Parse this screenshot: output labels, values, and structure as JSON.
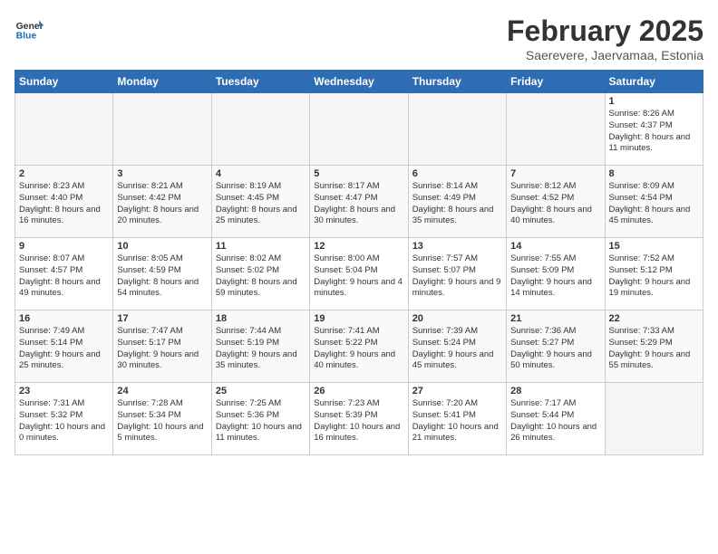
{
  "header": {
    "logo_general": "General",
    "logo_blue": "Blue",
    "title": "February 2025",
    "subtitle": "Saerevere, Jaervamaa, Estonia"
  },
  "days_of_week": [
    "Sunday",
    "Monday",
    "Tuesday",
    "Wednesday",
    "Thursday",
    "Friday",
    "Saturday"
  ],
  "weeks": [
    [
      {
        "day": "",
        "info": ""
      },
      {
        "day": "",
        "info": ""
      },
      {
        "day": "",
        "info": ""
      },
      {
        "day": "",
        "info": ""
      },
      {
        "day": "",
        "info": ""
      },
      {
        "day": "",
        "info": ""
      },
      {
        "day": "1",
        "info": "Sunrise: 8:26 AM\nSunset: 4:37 PM\nDaylight: 8 hours and 11 minutes."
      }
    ],
    [
      {
        "day": "2",
        "info": "Sunrise: 8:23 AM\nSunset: 4:40 PM\nDaylight: 8 hours and 16 minutes."
      },
      {
        "day": "3",
        "info": "Sunrise: 8:21 AM\nSunset: 4:42 PM\nDaylight: 8 hours and 20 minutes."
      },
      {
        "day": "4",
        "info": "Sunrise: 8:19 AM\nSunset: 4:45 PM\nDaylight: 8 hours and 25 minutes."
      },
      {
        "day": "5",
        "info": "Sunrise: 8:17 AM\nSunset: 4:47 PM\nDaylight: 8 hours and 30 minutes."
      },
      {
        "day": "6",
        "info": "Sunrise: 8:14 AM\nSunset: 4:49 PM\nDaylight: 8 hours and 35 minutes."
      },
      {
        "day": "7",
        "info": "Sunrise: 8:12 AM\nSunset: 4:52 PM\nDaylight: 8 hours and 40 minutes."
      },
      {
        "day": "8",
        "info": "Sunrise: 8:09 AM\nSunset: 4:54 PM\nDaylight: 8 hours and 45 minutes."
      }
    ],
    [
      {
        "day": "9",
        "info": "Sunrise: 8:07 AM\nSunset: 4:57 PM\nDaylight: 8 hours and 49 minutes."
      },
      {
        "day": "10",
        "info": "Sunrise: 8:05 AM\nSunset: 4:59 PM\nDaylight: 8 hours and 54 minutes."
      },
      {
        "day": "11",
        "info": "Sunrise: 8:02 AM\nSunset: 5:02 PM\nDaylight: 8 hours and 59 minutes."
      },
      {
        "day": "12",
        "info": "Sunrise: 8:00 AM\nSunset: 5:04 PM\nDaylight: 9 hours and 4 minutes."
      },
      {
        "day": "13",
        "info": "Sunrise: 7:57 AM\nSunset: 5:07 PM\nDaylight: 9 hours and 9 minutes."
      },
      {
        "day": "14",
        "info": "Sunrise: 7:55 AM\nSunset: 5:09 PM\nDaylight: 9 hours and 14 minutes."
      },
      {
        "day": "15",
        "info": "Sunrise: 7:52 AM\nSunset: 5:12 PM\nDaylight: 9 hours and 19 minutes."
      }
    ],
    [
      {
        "day": "16",
        "info": "Sunrise: 7:49 AM\nSunset: 5:14 PM\nDaylight: 9 hours and 25 minutes."
      },
      {
        "day": "17",
        "info": "Sunrise: 7:47 AM\nSunset: 5:17 PM\nDaylight: 9 hours and 30 minutes."
      },
      {
        "day": "18",
        "info": "Sunrise: 7:44 AM\nSunset: 5:19 PM\nDaylight: 9 hours and 35 minutes."
      },
      {
        "day": "19",
        "info": "Sunrise: 7:41 AM\nSunset: 5:22 PM\nDaylight: 9 hours and 40 minutes."
      },
      {
        "day": "20",
        "info": "Sunrise: 7:39 AM\nSunset: 5:24 PM\nDaylight: 9 hours and 45 minutes."
      },
      {
        "day": "21",
        "info": "Sunrise: 7:36 AM\nSunset: 5:27 PM\nDaylight: 9 hours and 50 minutes."
      },
      {
        "day": "22",
        "info": "Sunrise: 7:33 AM\nSunset: 5:29 PM\nDaylight: 9 hours and 55 minutes."
      }
    ],
    [
      {
        "day": "23",
        "info": "Sunrise: 7:31 AM\nSunset: 5:32 PM\nDaylight: 10 hours and 0 minutes."
      },
      {
        "day": "24",
        "info": "Sunrise: 7:28 AM\nSunset: 5:34 PM\nDaylight: 10 hours and 5 minutes."
      },
      {
        "day": "25",
        "info": "Sunrise: 7:25 AM\nSunset: 5:36 PM\nDaylight: 10 hours and 11 minutes."
      },
      {
        "day": "26",
        "info": "Sunrise: 7:23 AM\nSunset: 5:39 PM\nDaylight: 10 hours and 16 minutes."
      },
      {
        "day": "27",
        "info": "Sunrise: 7:20 AM\nSunset: 5:41 PM\nDaylight: 10 hours and 21 minutes."
      },
      {
        "day": "28",
        "info": "Sunrise: 7:17 AM\nSunset: 5:44 PM\nDaylight: 10 hours and 26 minutes."
      },
      {
        "day": "",
        "info": ""
      }
    ]
  ]
}
